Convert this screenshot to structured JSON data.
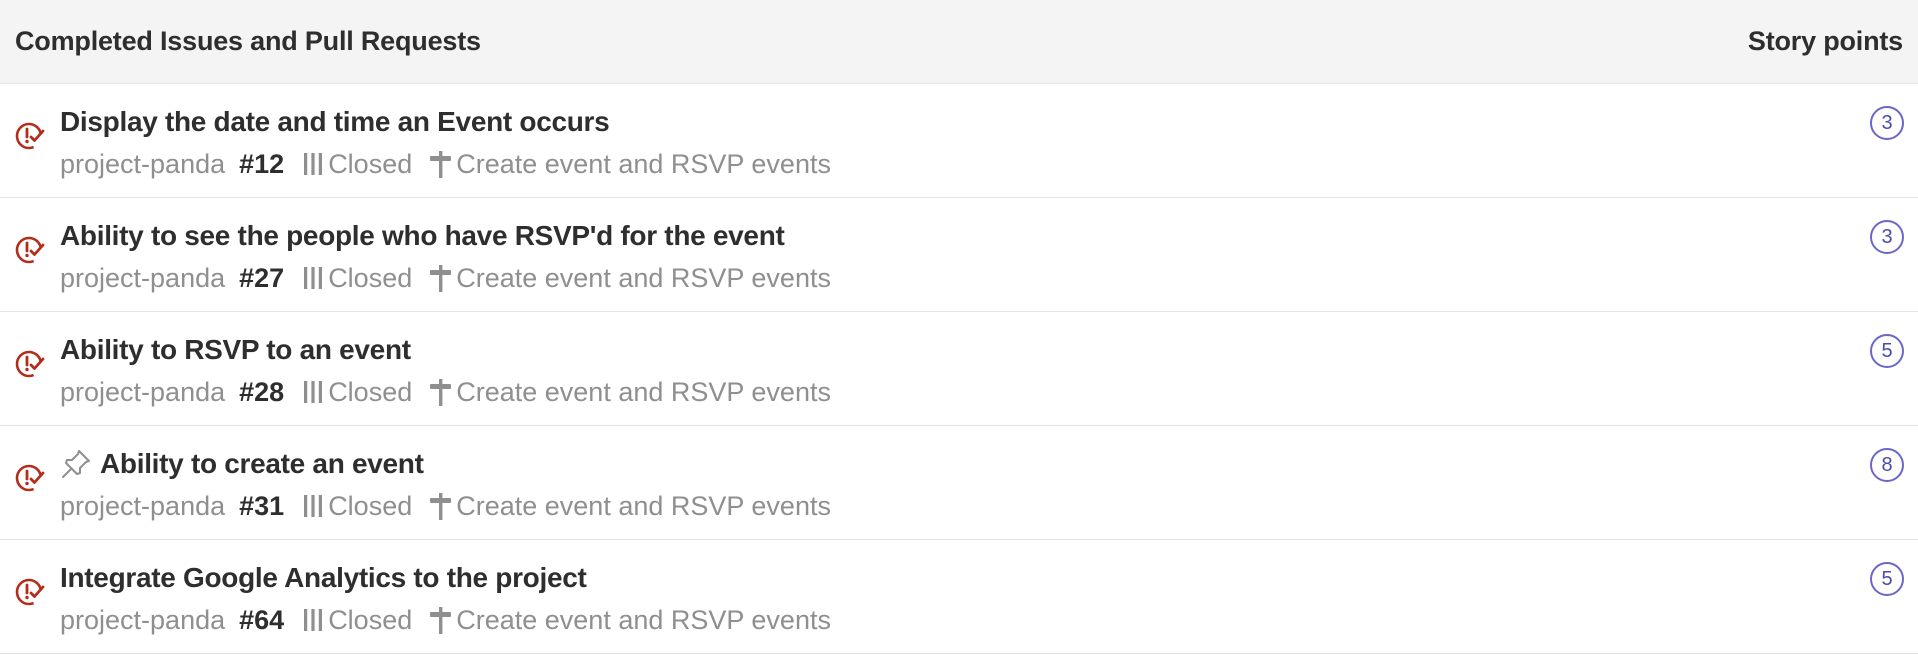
{
  "header": {
    "title": "Completed Issues and Pull Requests",
    "points_label": "Story points"
  },
  "colors": {
    "closed_icon": "#b32d1a",
    "badge_border": "#6b67c9",
    "muted_text": "#8f8f8f",
    "header_bg": "#f4f4f4"
  },
  "icons": {
    "status": "issue-closed-icon",
    "pinned": "pin-icon",
    "board": "board-columns-icon",
    "milestone": "milestone-signpost-icon"
  },
  "issues": [
    {
      "title": "Display the date and time an Event occurs",
      "pinned": false,
      "repo": "project-panda",
      "number": "#12",
      "state": "Closed",
      "milestone": "Create event and RSVP events",
      "points": "3"
    },
    {
      "title": "Ability to see the people who have RSVP'd for the event",
      "pinned": false,
      "repo": "project-panda",
      "number": "#27",
      "state": "Closed",
      "milestone": "Create event and RSVP events",
      "points": "3"
    },
    {
      "title": "Ability to RSVP to an event",
      "pinned": false,
      "repo": "project-panda",
      "number": "#28",
      "state": "Closed",
      "milestone": "Create event and RSVP events",
      "points": "5"
    },
    {
      "title": "Ability to create an event",
      "pinned": true,
      "repo": "project-panda",
      "number": "#31",
      "state": "Closed",
      "milestone": "Create event and RSVP events",
      "points": "8"
    },
    {
      "title": "Integrate Google Analytics to the project",
      "pinned": false,
      "repo": "project-panda",
      "number": "#64",
      "state": "Closed",
      "milestone": "Create event and RSVP events",
      "points": "5"
    }
  ]
}
